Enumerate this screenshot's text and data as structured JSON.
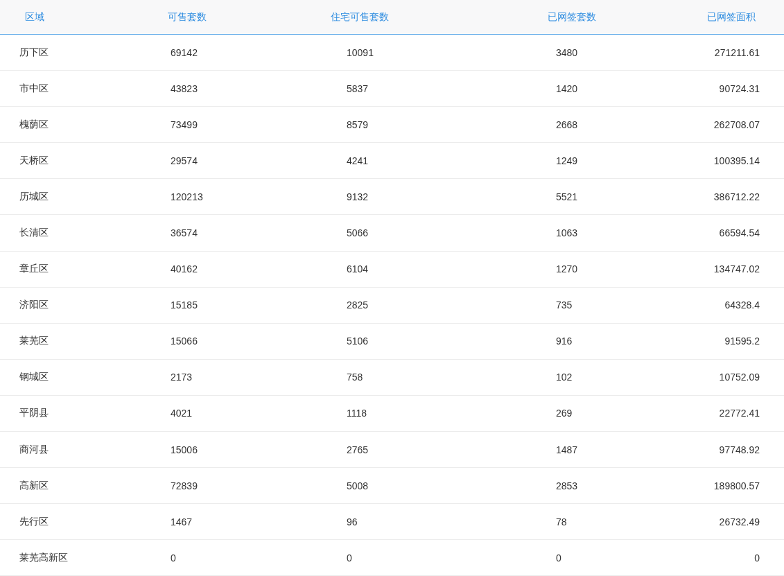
{
  "table": {
    "columns": [
      "区域",
      "可售套数",
      "住宅可售套数",
      "已网签套数",
      "已网签面积"
    ],
    "rows": [
      [
        "历下区",
        "69142",
        "10091",
        "3480",
        "271211.61"
      ],
      [
        "市中区",
        "43823",
        "5837",
        "1420",
        "90724.31"
      ],
      [
        "槐荫区",
        "73499",
        "8579",
        "2668",
        "262708.07"
      ],
      [
        "天桥区",
        "29574",
        "4241",
        "1249",
        "100395.14"
      ],
      [
        "历城区",
        "120213",
        "9132",
        "5521",
        "386712.22"
      ],
      [
        "长清区",
        "36574",
        "5066",
        "1063",
        "66594.54"
      ],
      [
        "章丘区",
        "40162",
        "6104",
        "1270",
        "134747.02"
      ],
      [
        "济阳区",
        "15185",
        "2825",
        "735",
        "64328.4"
      ],
      [
        "莱芜区",
        "15066",
        "5106",
        "916",
        "91595.2"
      ],
      [
        "钢城区",
        "2173",
        "758",
        "102",
        "10752.09"
      ],
      [
        "平阴县",
        "4021",
        "1118",
        "269",
        "22772.41"
      ],
      [
        "商河县",
        "15006",
        "2765",
        "1487",
        "97748.92"
      ],
      [
        "高新区",
        "72839",
        "5008",
        "2853",
        "189800.57"
      ],
      [
        "先行区",
        "1467",
        "96",
        "78",
        "26732.49"
      ],
      [
        "莱芜高新区",
        "0",
        "0",
        "0",
        "0"
      ]
    ]
  }
}
